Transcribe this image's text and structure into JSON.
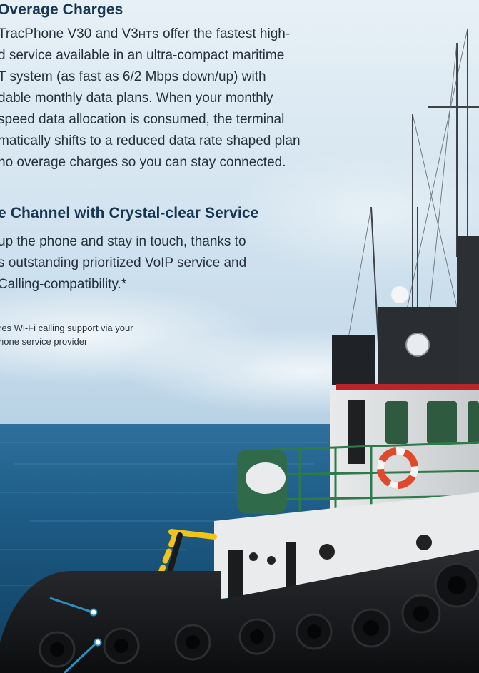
{
  "sections": [
    {
      "heading": "Overage Charges",
      "lines": [
        {
          "pre": "TracPhone V30 and V3",
          "sc": "HTS",
          "post": " offer the fastest high-"
        },
        {
          "pre": "d service available in an ultra-compact maritime"
        },
        {
          "pre": "T system (as fast as 6/2 Mbps down/up) with"
        },
        {
          "pre": "dable monthly data plans. When your monthly"
        },
        {
          "pre": "speed data allocation is consumed, the terminal"
        },
        {
          "pre": "matically shifts to a reduced data rate shaped plan"
        },
        {
          "pre": "no overage charges so you can stay connected."
        }
      ]
    },
    {
      "heading": "e Channel with Crystal-clear Service",
      "lines": [
        {
          "pre": "up the phone and stay in touch, thanks to"
        },
        {
          "pre": "s outstanding prioritized VoIP service and"
        },
        {
          "pre": " Calling-compatibility.*"
        }
      ]
    }
  ],
  "footnote": {
    "lines": [
      "res Wi-Fi calling support via your",
      "hone service provider"
    ]
  },
  "colors": {
    "heading": "#163654",
    "callout": "#2b8fc0",
    "sea": "#1f5f8a"
  }
}
